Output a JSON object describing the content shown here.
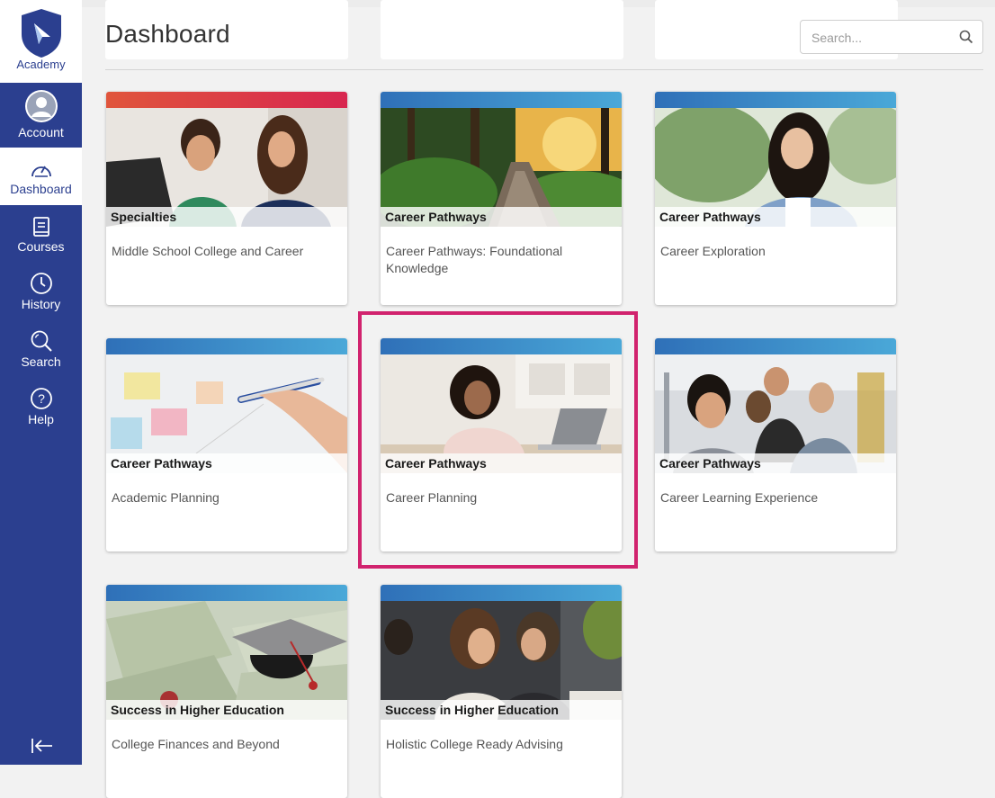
{
  "app": {
    "brand": "Academy",
    "accent": "#2b3f8f",
    "highlight_color": "#d1236e"
  },
  "sidebar": {
    "items": [
      {
        "label": "Account",
        "icon": "user-avatar-icon",
        "active": false
      },
      {
        "label": "Dashboard",
        "icon": "speedometer-icon",
        "active": true
      },
      {
        "label": "Courses",
        "icon": "book-icon",
        "active": false
      },
      {
        "label": "History",
        "icon": "clock-icon",
        "active": false
      },
      {
        "label": "Search",
        "icon": "magnifier-icon",
        "active": false
      },
      {
        "label": "Help",
        "icon": "help-circle-icon",
        "active": false
      }
    ],
    "collapse_icon": "collapse-left-icon"
  },
  "header": {
    "title": "Dashboard",
    "search": {
      "placeholder": "Search...",
      "value": "",
      "icon": "search-icon"
    }
  },
  "courses": [
    {
      "category": "Specialties",
      "title": "Middle School College and Career",
      "bar_color": "#e0493c"
    },
    {
      "category": "Career Pathways",
      "title": "Career Pathways: Foundational Knowledge",
      "bar_color": "#3d8fc9"
    },
    {
      "category": "Career Pathways",
      "title": "Career Exploration",
      "bar_color": "#3d8fc9"
    },
    {
      "category": "Career Pathways",
      "title": "Academic Planning",
      "bar_color": "#3d8fc9"
    },
    {
      "category": "Career Pathways",
      "title": "Career Planning",
      "bar_color": "#3d8fc9",
      "highlighted": true
    },
    {
      "category": "Career Pathways",
      "title": "Career Learning Experience",
      "bar_color": "#3d8fc9"
    },
    {
      "category": "Success in Higher Education",
      "title": "College Finances and Beyond",
      "bar_color": "#3d8fc9"
    },
    {
      "category": "Success in Higher Education",
      "title": "Holistic College Ready Advising",
      "bar_color": "#3d8fc9"
    }
  ]
}
